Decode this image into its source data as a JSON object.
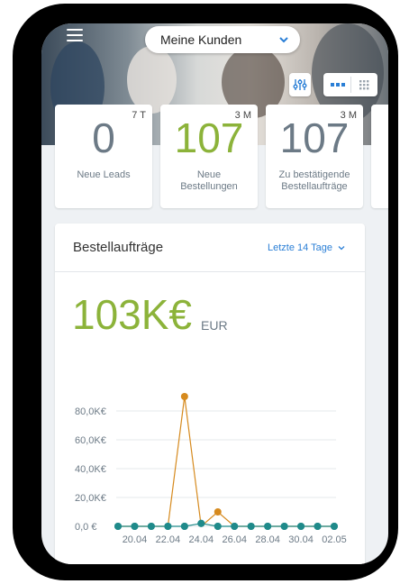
{
  "header": {
    "dropdown_label": "Meine Kunden",
    "icons": [
      "menu-icon",
      "filter-icon",
      "list-view-icon",
      "grid-view-icon"
    ]
  },
  "cards": [
    {
      "period": "7 T",
      "value": "0",
      "label_line1": "Neue Leads",
      "label_line2": "",
      "color": "#6c7a86"
    },
    {
      "period": "3 M",
      "value": "107",
      "label_line1": "Neue",
      "label_line2": "Bestellungen",
      "color": "#8cb33a"
    },
    {
      "period": "3 M",
      "value": "107",
      "label_line1": "Zu bestätigende",
      "label_line2": "Bestellaufträge",
      "color": "#6c7a86"
    }
  ],
  "panel": {
    "title": "Bestellaufträge",
    "period_label": "Letzte 14 Tage",
    "total_value": "103K€",
    "total_unit": "EUR"
  },
  "chart_data": {
    "type": "line",
    "x": [
      "19.04",
      "20.04",
      "21.04",
      "22.04",
      "23.04",
      "24.04",
      "25.04",
      "26.04",
      "27.04",
      "28.04",
      "29.04",
      "30.04",
      "01.05",
      "02.05"
    ],
    "x_tick_labels": [
      "20.04",
      "22.04",
      "24.04",
      "26.04",
      "28.04",
      "30.04",
      "02.05"
    ],
    "y_tick_labels": [
      "0,0 €",
      "20,0K€",
      "40,0K€",
      "60,0K€",
      "80,0K€"
    ],
    "ylim": [
      0,
      90000
    ],
    "series": [
      {
        "color": "#d68a1e",
        "values": [
          0,
          0,
          0,
          0,
          90000,
          0,
          10000,
          0,
          0,
          0,
          0,
          0,
          0,
          0
        ]
      },
      {
        "color": "#1f8a8a",
        "values": [
          0,
          0,
          0,
          0,
          0,
          2000,
          0,
          0,
          0,
          0,
          0,
          0,
          0,
          0
        ]
      }
    ],
    "grid": true
  }
}
